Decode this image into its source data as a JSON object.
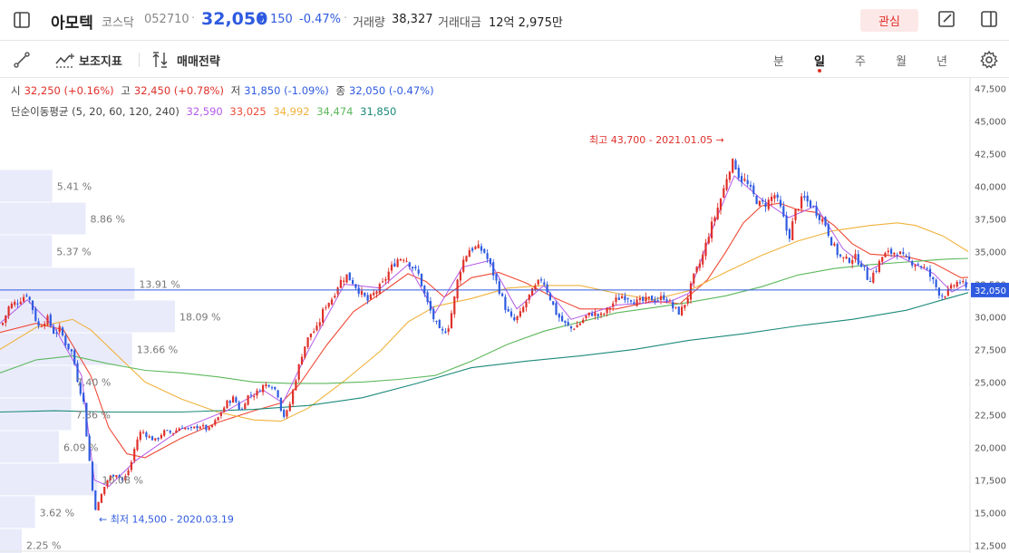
{
  "header": {
    "stock_name": "아모텍",
    "market": "코스닥",
    "code": "052710",
    "price": "32,050",
    "change_arrow": "▼",
    "change_abs": "150",
    "change_pct": "-0.47%",
    "volume_label": "거래량",
    "volume_value": "38,327",
    "amount_label": "거래대금",
    "amount_value": "12억 2,975만",
    "interest_label": "관심"
  },
  "toolbar": {
    "indicator_label": "보조지표",
    "strategy_label": "매매전략",
    "periods": [
      "분",
      "일",
      "주",
      "월",
      "년"
    ],
    "active_period": "일"
  },
  "ohlc_info": {
    "open_label": "시",
    "open_value": "32,250 (+0.16%)",
    "high_label": "고",
    "high_value": "32,450 (+0.78%)",
    "low_label": "저",
    "low_value": "31,850 (-1.09%)",
    "close_label": "종",
    "close_value": "32,050 (-0.47%)"
  },
  "ma_info": {
    "label": "단순이동평균 (5, 20, 60, 120, 240)",
    "values": [
      "32,590",
      "33,025",
      "34,992",
      "34,474",
      "31,850"
    ]
  },
  "colors": {
    "up": "#e0302a",
    "down": "#2f5be0",
    "ma5": "#b55be8",
    "ma20": "#ef4a36",
    "ma60": "#f0b23c",
    "ma120": "#5cb85c",
    "ma240": "#1b8a7a",
    "volume_profile": "#e9ebfb",
    "current_line": "#2f5be0"
  },
  "chart_data": {
    "type": "candlestick",
    "y_ticks": [
      "47,500",
      "45,000",
      "42,500",
      "40,000",
      "37,500",
      "35,000",
      "32,500",
      "30,000",
      "27,500",
      "25,000",
      "22,500",
      "20,000",
      "17,500",
      "15,000",
      "12,500"
    ],
    "y_tick_values": [
      47500,
      45000,
      42500,
      40000,
      37500,
      35000,
      32500,
      30000,
      27500,
      25000,
      22500,
      20000,
      17500,
      15000,
      12500
    ],
    "ylim": [
      11900,
      48300
    ],
    "current_price": 32050,
    "current_price_label": "32,050",
    "high_annotation": "최고 43,700 - 2021.01.05",
    "high_value": 43700,
    "low_annotation": "최저 14,500 - 2020.03.19",
    "low_value": 14500,
    "volume_profile": [
      {
        "price": 40000,
        "label": "5.41 %",
        "pct": 5.41
      },
      {
        "price": 37500,
        "label": "8.86 %",
        "pct": 8.86
      },
      {
        "price": 35000,
        "label": "5.37 %",
        "pct": 5.37
      },
      {
        "price": 32500,
        "label": "13.91 %",
        "pct": 13.91
      },
      {
        "price": 30000,
        "label": "18.09 %",
        "pct": 18.09
      },
      {
        "price": 27500,
        "label": "13.66 %",
        "pct": 13.66
      },
      {
        "price": 25000,
        "label": "7.40 %",
        "pct": 7.4
      },
      {
        "price": 22500,
        "label": "7.36 %",
        "pct": 7.36
      },
      {
        "price": 20000,
        "label": "6.09 %",
        "pct": 6.09
      },
      {
        "price": 17500,
        "label": "10.08 %",
        "pct": 10.08
      },
      {
        "price": 15000,
        "label": "3.62 %",
        "pct": 3.62
      },
      {
        "price": 12500,
        "label": "2.25 %",
        "pct": 2.25
      }
    ],
    "close_path": [
      [
        0,
        29000
      ],
      [
        10,
        30800
      ],
      [
        20,
        31200
      ],
      [
        30,
        31800
      ],
      [
        36,
        30600
      ],
      [
        42,
        29200
      ],
      [
        52,
        29900
      ],
      [
        60,
        28700
      ],
      [
        66,
        29100
      ],
      [
        72,
        28000
      ],
      [
        80,
        27200
      ],
      [
        86,
        25000
      ],
      [
        92,
        23500
      ],
      [
        96,
        20500
      ],
      [
        100,
        18200
      ],
      [
        104,
        15200
      ],
      [
        108,
        15600
      ],
      [
        114,
        16800
      ],
      [
        120,
        17700
      ],
      [
        128,
        18000
      ],
      [
        136,
        17400
      ],
      [
        144,
        18600
      ],
      [
        150,
        20400
      ],
      [
        156,
        21300
      ],
      [
        164,
        20800
      ],
      [
        172,
        20500
      ],
      [
        180,
        21200
      ],
      [
        190,
        21100
      ],
      [
        200,
        21600
      ],
      [
        210,
        21300
      ],
      [
        220,
        21700
      ],
      [
        230,
        21300
      ],
      [
        240,
        22200
      ],
      [
        250,
        23400
      ],
      [
        258,
        23800
      ],
      [
        266,
        22700
      ],
      [
        272,
        23900
      ],
      [
        282,
        24100
      ],
      [
        290,
        24700
      ],
      [
        298,
        24900
      ],
      [
        306,
        24200
      ],
      [
        312,
        22300
      ],
      [
        318,
        22800
      ],
      [
        326,
        25200
      ],
      [
        334,
        27400
      ],
      [
        342,
        28700
      ],
      [
        350,
        29100
      ],
      [
        358,
        30800
      ],
      [
        366,
        31400
      ],
      [
        374,
        32600
      ],
      [
        382,
        33200
      ],
      [
        390,
        32600
      ],
      [
        398,
        31800
      ],
      [
        406,
        31200
      ],
      [
        414,
        31900
      ],
      [
        422,
        32500
      ],
      [
        430,
        33600
      ],
      [
        438,
        34400
      ],
      [
        446,
        34600
      ],
      [
        454,
        33900
      ],
      [
        462,
        33200
      ],
      [
        470,
        31300
      ],
      [
        478,
        29900
      ],
      [
        486,
        28700
      ],
      [
        494,
        29100
      ],
      [
        500,
        30900
      ],
      [
        506,
        33300
      ],
      [
        512,
        34500
      ],
      [
        518,
        35200
      ],
      [
        526,
        35300
      ],
      [
        534,
        35000
      ],
      [
        542,
        33700
      ],
      [
        550,
        32200
      ],
      [
        558,
        30600
      ],
      [
        566,
        29600
      ],
      [
        574,
        30200
      ],
      [
        582,
        31400
      ],
      [
        590,
        32200
      ],
      [
        598,
        33000
      ],
      [
        606,
        31600
      ],
      [
        614,
        30200
      ],
      [
        622,
        29500
      ],
      [
        630,
        29100
      ],
      [
        638,
        29400
      ],
      [
        646,
        30000
      ],
      [
        654,
        30300
      ],
      [
        662,
        30000
      ],
      [
        670,
        30500
      ],
      [
        678,
        31200
      ],
      [
        686,
        31600
      ],
      [
        694,
        31500
      ],
      [
        702,
        31100
      ],
      [
        710,
        31200
      ],
      [
        718,
        31400
      ],
      [
        726,
        31300
      ],
      [
        734,
        31600
      ],
      [
        742,
        30700
      ],
      [
        750,
        30300
      ],
      [
        758,
        31400
      ],
      [
        766,
        33200
      ],
      [
        774,
        34400
      ],
      [
        782,
        36400
      ],
      [
        790,
        38000
      ],
      [
        798,
        39700
      ],
      [
        804,
        41400
      ],
      [
        810,
        41900
      ],
      [
        816,
        40600
      ],
      [
        822,
        40400
      ],
      [
        830,
        39400
      ],
      [
        838,
        38600
      ],
      [
        846,
        38700
      ],
      [
        854,
        39400
      ],
      [
        862,
        38100
      ],
      [
        870,
        36000
      ],
      [
        878,
        38200
      ],
      [
        886,
        39100
      ],
      [
        894,
        38600
      ],
      [
        902,
        37900
      ],
      [
        910,
        37200
      ],
      [
        918,
        35600
      ],
      [
        926,
        34600
      ],
      [
        934,
        34300
      ],
      [
        942,
        34600
      ],
      [
        950,
        34100
      ],
      [
        958,
        32800
      ],
      [
        966,
        33600
      ],
      [
        974,
        34700
      ],
      [
        982,
        34900
      ],
      [
        990,
        35000
      ],
      [
        998,
        34400
      ],
      [
        1006,
        34200
      ],
      [
        1014,
        34000
      ],
      [
        1022,
        33600
      ],
      [
        1030,
        32600
      ],
      [
        1038,
        31600
      ],
      [
        1046,
        31900
      ],
      [
        1054,
        32600
      ],
      [
        1060,
        32700
      ],
      [
        1066,
        32050
      ]
    ],
    "moving_averages": [
      {
        "name": "ma20",
        "points": [
          [
            0,
            28800
          ],
          [
            40,
            29500
          ],
          [
            70,
            29000
          ],
          [
            100,
            25500
          ],
          [
            120,
            21500
          ],
          [
            140,
            19500
          ],
          [
            160,
            19200
          ],
          [
            200,
            20700
          ],
          [
            240,
            21900
          ],
          [
            280,
            22800
          ],
          [
            310,
            23400
          ],
          [
            330,
            24800
          ],
          [
            360,
            27800
          ],
          [
            390,
            30400
          ],
          [
            420,
            31800
          ],
          [
            450,
            33300
          ],
          [
            470,
            32700
          ],
          [
            490,
            31500
          ],
          [
            520,
            33000
          ],
          [
            550,
            33400
          ],
          [
            580,
            32600
          ],
          [
            610,
            31500
          ],
          [
            640,
            30600
          ],
          [
            680,
            30600
          ],
          [
            720,
            31200
          ],
          [
            750,
            31000
          ],
          [
            780,
            32800
          ],
          [
            800,
            34900
          ],
          [
            820,
            37200
          ],
          [
            840,
            38500
          ],
          [
            860,
            38700
          ],
          [
            880,
            38200
          ],
          [
            900,
            38000
          ],
          [
            920,
            37000
          ],
          [
            940,
            35600
          ],
          [
            960,
            34800
          ],
          [
            980,
            34700
          ],
          [
            1000,
            34600
          ],
          [
            1030,
            34100
          ],
          [
            1060,
            33000
          ],
          [
            1068,
            33025
          ]
        ]
      },
      {
        "name": "ma60",
        "points": [
          [
            0,
            27500
          ],
          [
            40,
            29200
          ],
          [
            80,
            29800
          ],
          [
            100,
            29000
          ],
          [
            130,
            27000
          ],
          [
            160,
            25000
          ],
          [
            200,
            23700
          ],
          [
            240,
            22700
          ],
          [
            280,
            22100
          ],
          [
            310,
            22000
          ],
          [
            340,
            23000
          ],
          [
            380,
            25100
          ],
          [
            420,
            27400
          ],
          [
            450,
            29600
          ],
          [
            480,
            30800
          ],
          [
            520,
            31400
          ],
          [
            560,
            32200
          ],
          [
            600,
            32400
          ],
          [
            640,
            32400
          ],
          [
            680,
            31800
          ],
          [
            720,
            31300
          ],
          [
            760,
            32000
          ],
          [
            800,
            33400
          ],
          [
            840,
            34700
          ],
          [
            880,
            35800
          ],
          [
            920,
            36600
          ],
          [
            960,
            37000
          ],
          [
            990,
            37200
          ],
          [
            1010,
            37000
          ],
          [
            1040,
            36200
          ],
          [
            1068,
            35000
          ]
        ]
      },
      {
        "name": "ma120",
        "points": [
          [
            0,
            25700
          ],
          [
            40,
            26700
          ],
          [
            80,
            27000
          ],
          [
            120,
            26400
          ],
          [
            160,
            25900
          ],
          [
            200,
            25700
          ],
          [
            240,
            25400
          ],
          [
            280,
            25000
          ],
          [
            320,
            24900
          ],
          [
            360,
            24900
          ],
          [
            400,
            25000
          ],
          [
            440,
            25200
          ],
          [
            480,
            25500
          ],
          [
            520,
            26600
          ],
          [
            560,
            27900
          ],
          [
            600,
            28900
          ],
          [
            640,
            29600
          ],
          [
            680,
            30300
          ],
          [
            720,
            30700
          ],
          [
            760,
            31100
          ],
          [
            800,
            31600
          ],
          [
            840,
            32300
          ],
          [
            880,
            33200
          ],
          [
            920,
            33700
          ],
          [
            960,
            34000
          ],
          [
            1000,
            34200
          ],
          [
            1040,
            34400
          ],
          [
            1068,
            34474
          ]
        ]
      },
      {
        "name": "ma240",
        "points": [
          [
            0,
            22700
          ],
          [
            60,
            22800
          ],
          [
            120,
            22700
          ],
          [
            200,
            22700
          ],
          [
            280,
            22900
          ],
          [
            340,
            23200
          ],
          [
            400,
            23800
          ],
          [
            460,
            24900
          ],
          [
            520,
            26100
          ],
          [
            580,
            26600
          ],
          [
            640,
            27000
          ],
          [
            700,
            27500
          ],
          [
            760,
            28200
          ],
          [
            820,
            28700
          ],
          [
            880,
            29300
          ],
          [
            940,
            29800
          ],
          [
            1000,
            30500
          ],
          [
            1040,
            31300
          ],
          [
            1068,
            31850
          ]
        ]
      },
      {
        "name": "ma5",
        "points": [
          [
            0,
            29500
          ],
          [
            30,
            31300
          ],
          [
            60,
            29200
          ],
          [
            90,
            25500
          ],
          [
            104,
            17500
          ],
          [
            120,
            17000
          ],
          [
            150,
            19000
          ],
          [
            200,
            21400
          ],
          [
            250,
            22800
          ],
          [
            290,
            24400
          ],
          [
            312,
            23400
          ],
          [
            340,
            27400
          ],
          [
            380,
            32500
          ],
          [
            420,
            32200
          ],
          [
            450,
            34000
          ],
          [
            480,
            30300
          ],
          [
            510,
            33800
          ],
          [
            540,
            34300
          ],
          [
            570,
            30600
          ],
          [
            600,
            32400
          ],
          [
            630,
            29800
          ],
          [
            680,
            30900
          ],
          [
            740,
            31200
          ],
          [
            760,
            31800
          ],
          [
            790,
            37500
          ],
          [
            810,
            40800
          ],
          [
            840,
            39000
          ],
          [
            870,
            37600
          ],
          [
            900,
            38500
          ],
          [
            930,
            35200
          ],
          [
            960,
            33600
          ],
          [
            990,
            34700
          ],
          [
            1030,
            33300
          ],
          [
            1050,
            31900
          ],
          [
            1068,
            32590
          ]
        ]
      }
    ]
  }
}
